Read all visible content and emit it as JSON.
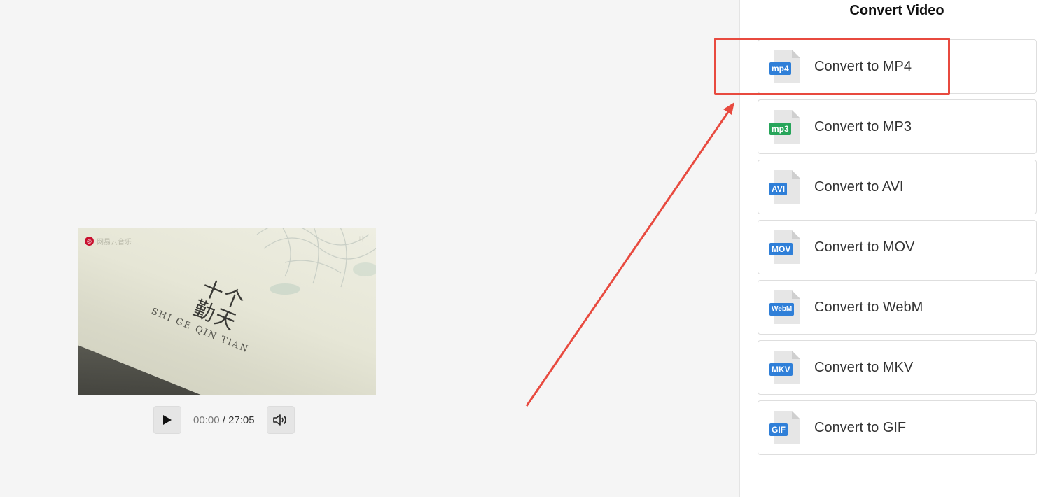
{
  "video": {
    "watermark": "网易云音乐",
    "corner_mark": "ㄐ",
    "art_title": "十个\n勤天",
    "art_subtitle": "SHI GE QIN TIAN",
    "current_time": "00:00",
    "separator": " / ",
    "duration": "27:05"
  },
  "panel": {
    "title": "Convert Video",
    "options": [
      {
        "badge": "mp4",
        "label": "Convert to MP4",
        "color": "#2f7fd8"
      },
      {
        "badge": "mp3",
        "label": "Convert to MP3",
        "color": "#27a55a"
      },
      {
        "badge": "AVI",
        "label": "Convert to AVI",
        "color": "#2f7fd8"
      },
      {
        "badge": "MOV",
        "label": "Convert to MOV",
        "color": "#2f7fd8"
      },
      {
        "badge": "WebM",
        "label": "Convert to WebM",
        "color": "#2f7fd8"
      },
      {
        "badge": "MKV",
        "label": "Convert to MKV",
        "color": "#2f7fd8"
      },
      {
        "badge": "GIF",
        "label": "Convert to GIF",
        "color": "#2f7fd8"
      }
    ]
  },
  "annotation": {
    "color": "#e84a3f"
  }
}
